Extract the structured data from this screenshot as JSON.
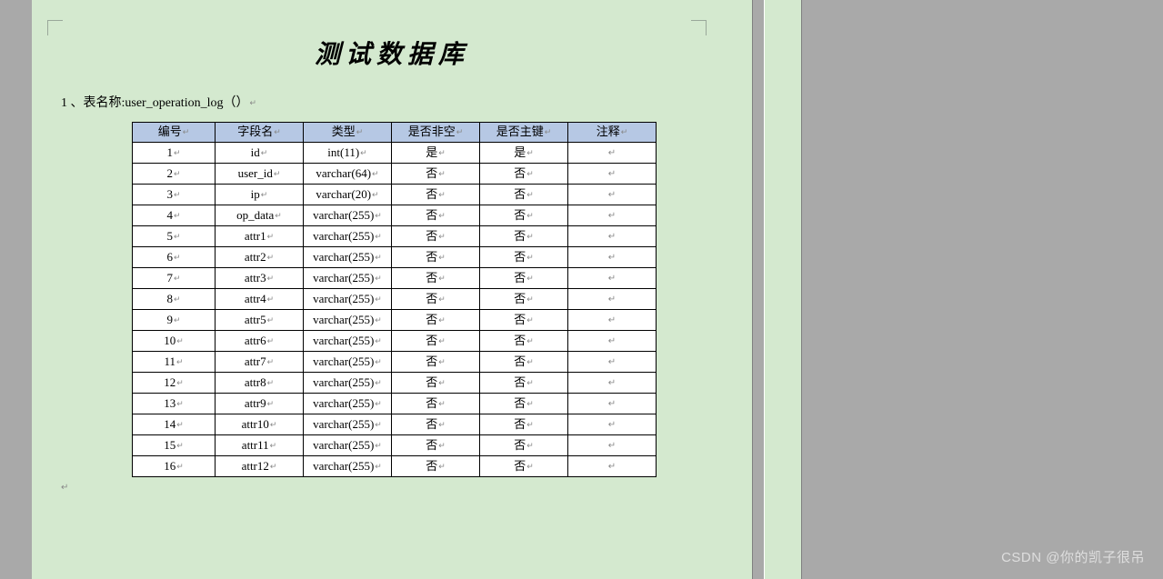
{
  "document": {
    "title": "测试数据库",
    "section_label": "1 、表名称:user_operation_log（）",
    "end_mark": "↵"
  },
  "table": {
    "headers": [
      "编号",
      "字段名",
      "类型",
      "是否非空",
      "是否主键",
      "注释"
    ],
    "rows": [
      {
        "num": "1",
        "field": "id",
        "type": "int(11)",
        "notnull": "是",
        "pk": "是",
        "comment": ""
      },
      {
        "num": "2",
        "field": "user_id",
        "type": "varchar(64)",
        "notnull": "否",
        "pk": "否",
        "comment": ""
      },
      {
        "num": "3",
        "field": "ip",
        "type": "varchar(20)",
        "notnull": "否",
        "pk": "否",
        "comment": ""
      },
      {
        "num": "4",
        "field": "op_data",
        "type": "varchar(255)",
        "notnull": "否",
        "pk": "否",
        "comment": ""
      },
      {
        "num": "5",
        "field": "attr1",
        "type": "varchar(255)",
        "notnull": "否",
        "pk": "否",
        "comment": ""
      },
      {
        "num": "6",
        "field": "attr2",
        "type": "varchar(255)",
        "notnull": "否",
        "pk": "否",
        "comment": ""
      },
      {
        "num": "7",
        "field": "attr3",
        "type": "varchar(255)",
        "notnull": "否",
        "pk": "否",
        "comment": ""
      },
      {
        "num": "8",
        "field": "attr4",
        "type": "varchar(255)",
        "notnull": "否",
        "pk": "否",
        "comment": ""
      },
      {
        "num": "9",
        "field": "attr5",
        "type": "varchar(255)",
        "notnull": "否",
        "pk": "否",
        "comment": ""
      },
      {
        "num": "10",
        "field": "attr6",
        "type": "varchar(255)",
        "notnull": "否",
        "pk": "否",
        "comment": ""
      },
      {
        "num": "11",
        "field": "attr7",
        "type": "varchar(255)",
        "notnull": "否",
        "pk": "否",
        "comment": ""
      },
      {
        "num": "12",
        "field": "attr8",
        "type": "varchar(255)",
        "notnull": "否",
        "pk": "否",
        "comment": ""
      },
      {
        "num": "13",
        "field": "attr9",
        "type": "varchar(255)",
        "notnull": "否",
        "pk": "否",
        "comment": ""
      },
      {
        "num": "14",
        "field": "attr10",
        "type": "varchar(255)",
        "notnull": "否",
        "pk": "否",
        "comment": ""
      },
      {
        "num": "15",
        "field": "attr11",
        "type": "varchar(255)",
        "notnull": "否",
        "pk": "否",
        "comment": ""
      },
      {
        "num": "16",
        "field": "attr12",
        "type": "varchar(255)",
        "notnull": "否",
        "pk": "否",
        "comment": ""
      }
    ]
  },
  "watermark": "CSDN @你的凯子很吊",
  "glyphs": {
    "paragraph_mark": "↵"
  }
}
